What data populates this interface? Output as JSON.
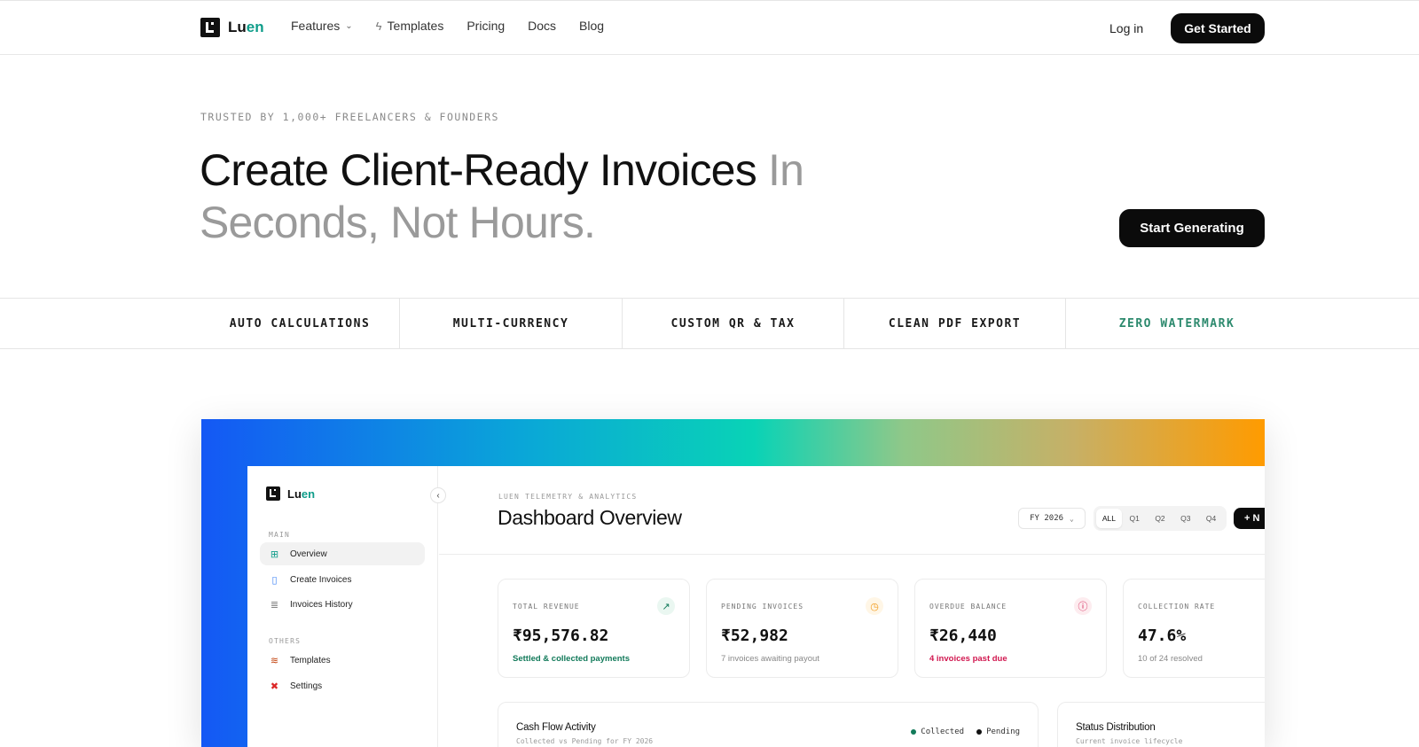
{
  "brand": {
    "name_main": "Lu",
    "name_accent": "en"
  },
  "nav": {
    "links": [
      {
        "label": "Features",
        "has_dropdown": true
      },
      {
        "label": "Templates",
        "icon": "lightning-icon"
      },
      {
        "label": "Pricing"
      },
      {
        "label": "Docs"
      },
      {
        "label": "Blog"
      }
    ],
    "login": "Log in",
    "cta": "Get Started"
  },
  "hero": {
    "eyebrow": "TRUSTED BY 1,000+ FREELANCERS & FOUNDERS",
    "title_dark": "Create Client-Ready Invoices ",
    "title_muted": "In Seconds, Not Hours.",
    "cta": "Start Generating"
  },
  "features": [
    "AUTO CALCULATIONS",
    "MULTI-CURRENCY",
    "CUSTOM QR & TAX",
    "CLEAN PDF EXPORT",
    "ZERO WATERMARK"
  ],
  "colors": {
    "accent": "#0f9d8a",
    "dark": "#0b0b0b",
    "positive": "#127a5a",
    "negative": "#d1174f",
    "warning": "#f29a1a"
  },
  "dashboard": {
    "sidebar": {
      "section_main": "MAIN",
      "main_items": [
        {
          "label": "Overview",
          "icon": "grid-icon",
          "active": true
        },
        {
          "label": "Create Invoices",
          "icon": "document-icon"
        },
        {
          "label": "Invoices History",
          "icon": "list-document-icon"
        }
      ],
      "section_others": "OTHERS",
      "other_items": [
        {
          "label": "Templates",
          "icon": "layers-icon"
        },
        {
          "label": "Settings",
          "icon": "tools-icon"
        }
      ]
    },
    "eyebrow": "LUEN TELEMETRY & ANALYTICS",
    "title": "Dashboard Overview",
    "fiscal_year": "FY 2026",
    "quarters": [
      "ALL",
      "Q1",
      "Q2",
      "Q3",
      "Q4"
    ],
    "selected_quarter": "ALL",
    "new_button": "+ N",
    "cards": [
      {
        "label": "TOTAL REVENUE",
        "value": "₹95,576.82",
        "sub": "Settled & collected payments",
        "icon": "trend-up-icon"
      },
      {
        "label": "PENDING INVOICES",
        "value": "₹52,982",
        "sub": "7 invoices awaiting payout",
        "icon": "clock-icon"
      },
      {
        "label": "OVERDUE BALANCE",
        "value": "₹26,440",
        "sub": "4 invoices past due",
        "icon": "alert-icon"
      },
      {
        "label": "COLLECTION RATE",
        "value": "47.6%",
        "sub": "10 of 24 resolved",
        "icon": ""
      }
    ],
    "cashflow": {
      "title": "Cash Flow Activity",
      "subtitle": "Collected vs Pending for FY 2026",
      "legend": [
        "Collected",
        "Pending"
      ]
    },
    "status": {
      "title": "Status Distribution",
      "subtitle": "Current invoice lifecycle"
    }
  }
}
